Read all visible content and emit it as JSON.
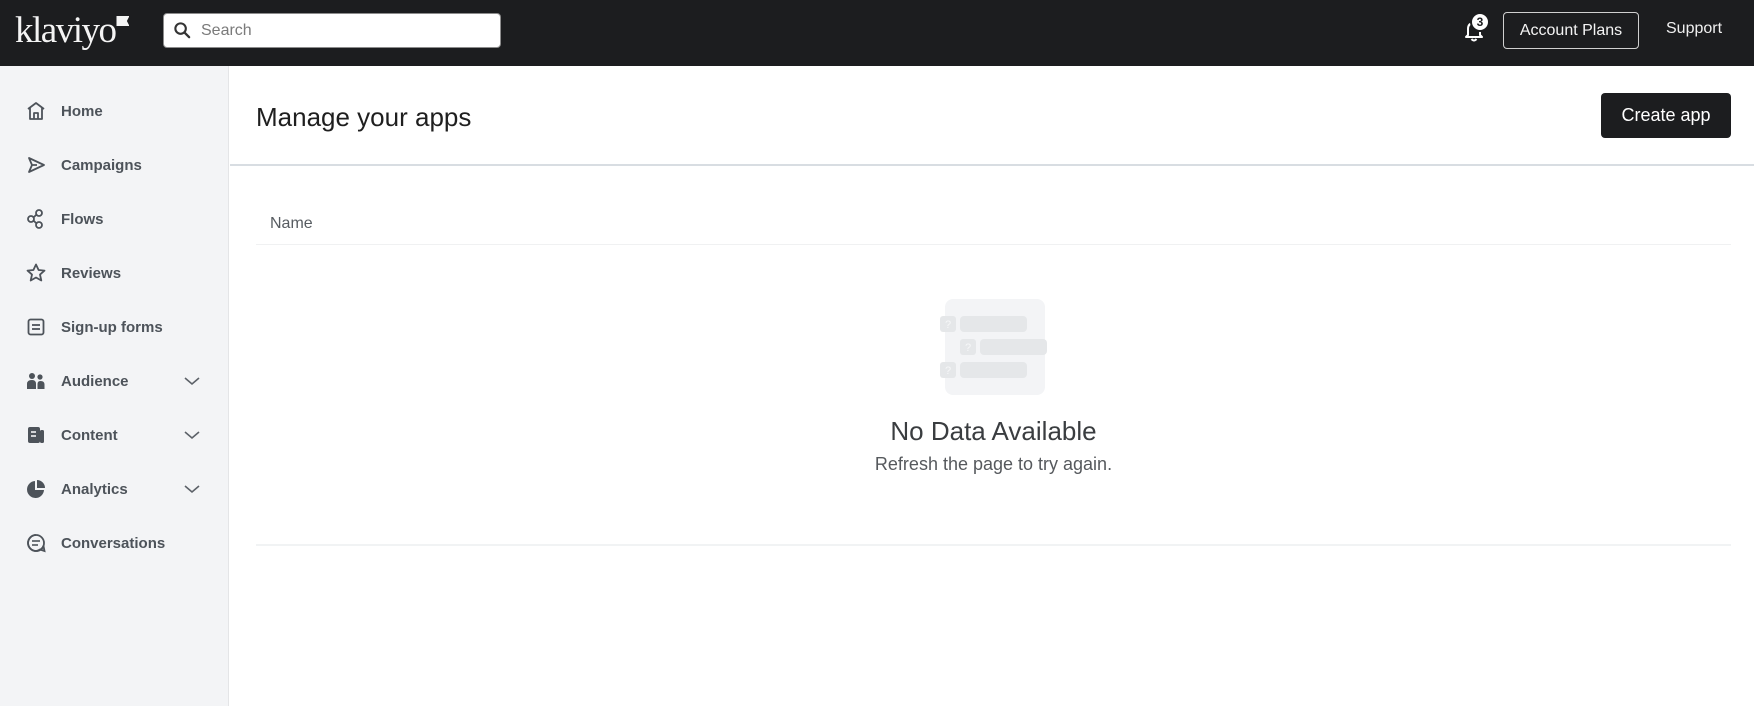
{
  "topbar": {
    "logo_text": "klaviyo",
    "search": {
      "placeholder": "Search",
      "value": ""
    },
    "notifications": {
      "count": "3"
    },
    "account_plans_label": "Account Plans",
    "support_label": "Support"
  },
  "sidebar": {
    "items": [
      {
        "label": "Home",
        "icon": "home-icon",
        "expandable": false
      },
      {
        "label": "Campaigns",
        "icon": "send-icon",
        "expandable": false
      },
      {
        "label": "Flows",
        "icon": "flows-icon",
        "expandable": false
      },
      {
        "label": "Reviews",
        "icon": "star-icon",
        "expandable": false
      },
      {
        "label": "Sign-up forms",
        "icon": "form-icon",
        "expandable": false
      },
      {
        "label": "Audience",
        "icon": "users-icon",
        "expandable": true
      },
      {
        "label": "Content",
        "icon": "content-icon",
        "expandable": true
      },
      {
        "label": "Analytics",
        "icon": "pie-chart-icon",
        "expandable": true
      },
      {
        "label": "Conversations",
        "icon": "chat-icon",
        "expandable": false
      }
    ]
  },
  "main": {
    "title": "Manage your apps",
    "create_button_label": "Create app",
    "table": {
      "columns": [
        "Name"
      ],
      "rows": []
    },
    "empty_state": {
      "title": "No Data Available",
      "subtitle": "Refresh the page to try again.",
      "illustration_glyph": "?"
    }
  },
  "colors": {
    "topbar_bg": "#1c1d1f",
    "sidebar_bg": "#f3f4f6",
    "primary_button": "#1c1d1f",
    "nav_text": "#4d535a"
  }
}
